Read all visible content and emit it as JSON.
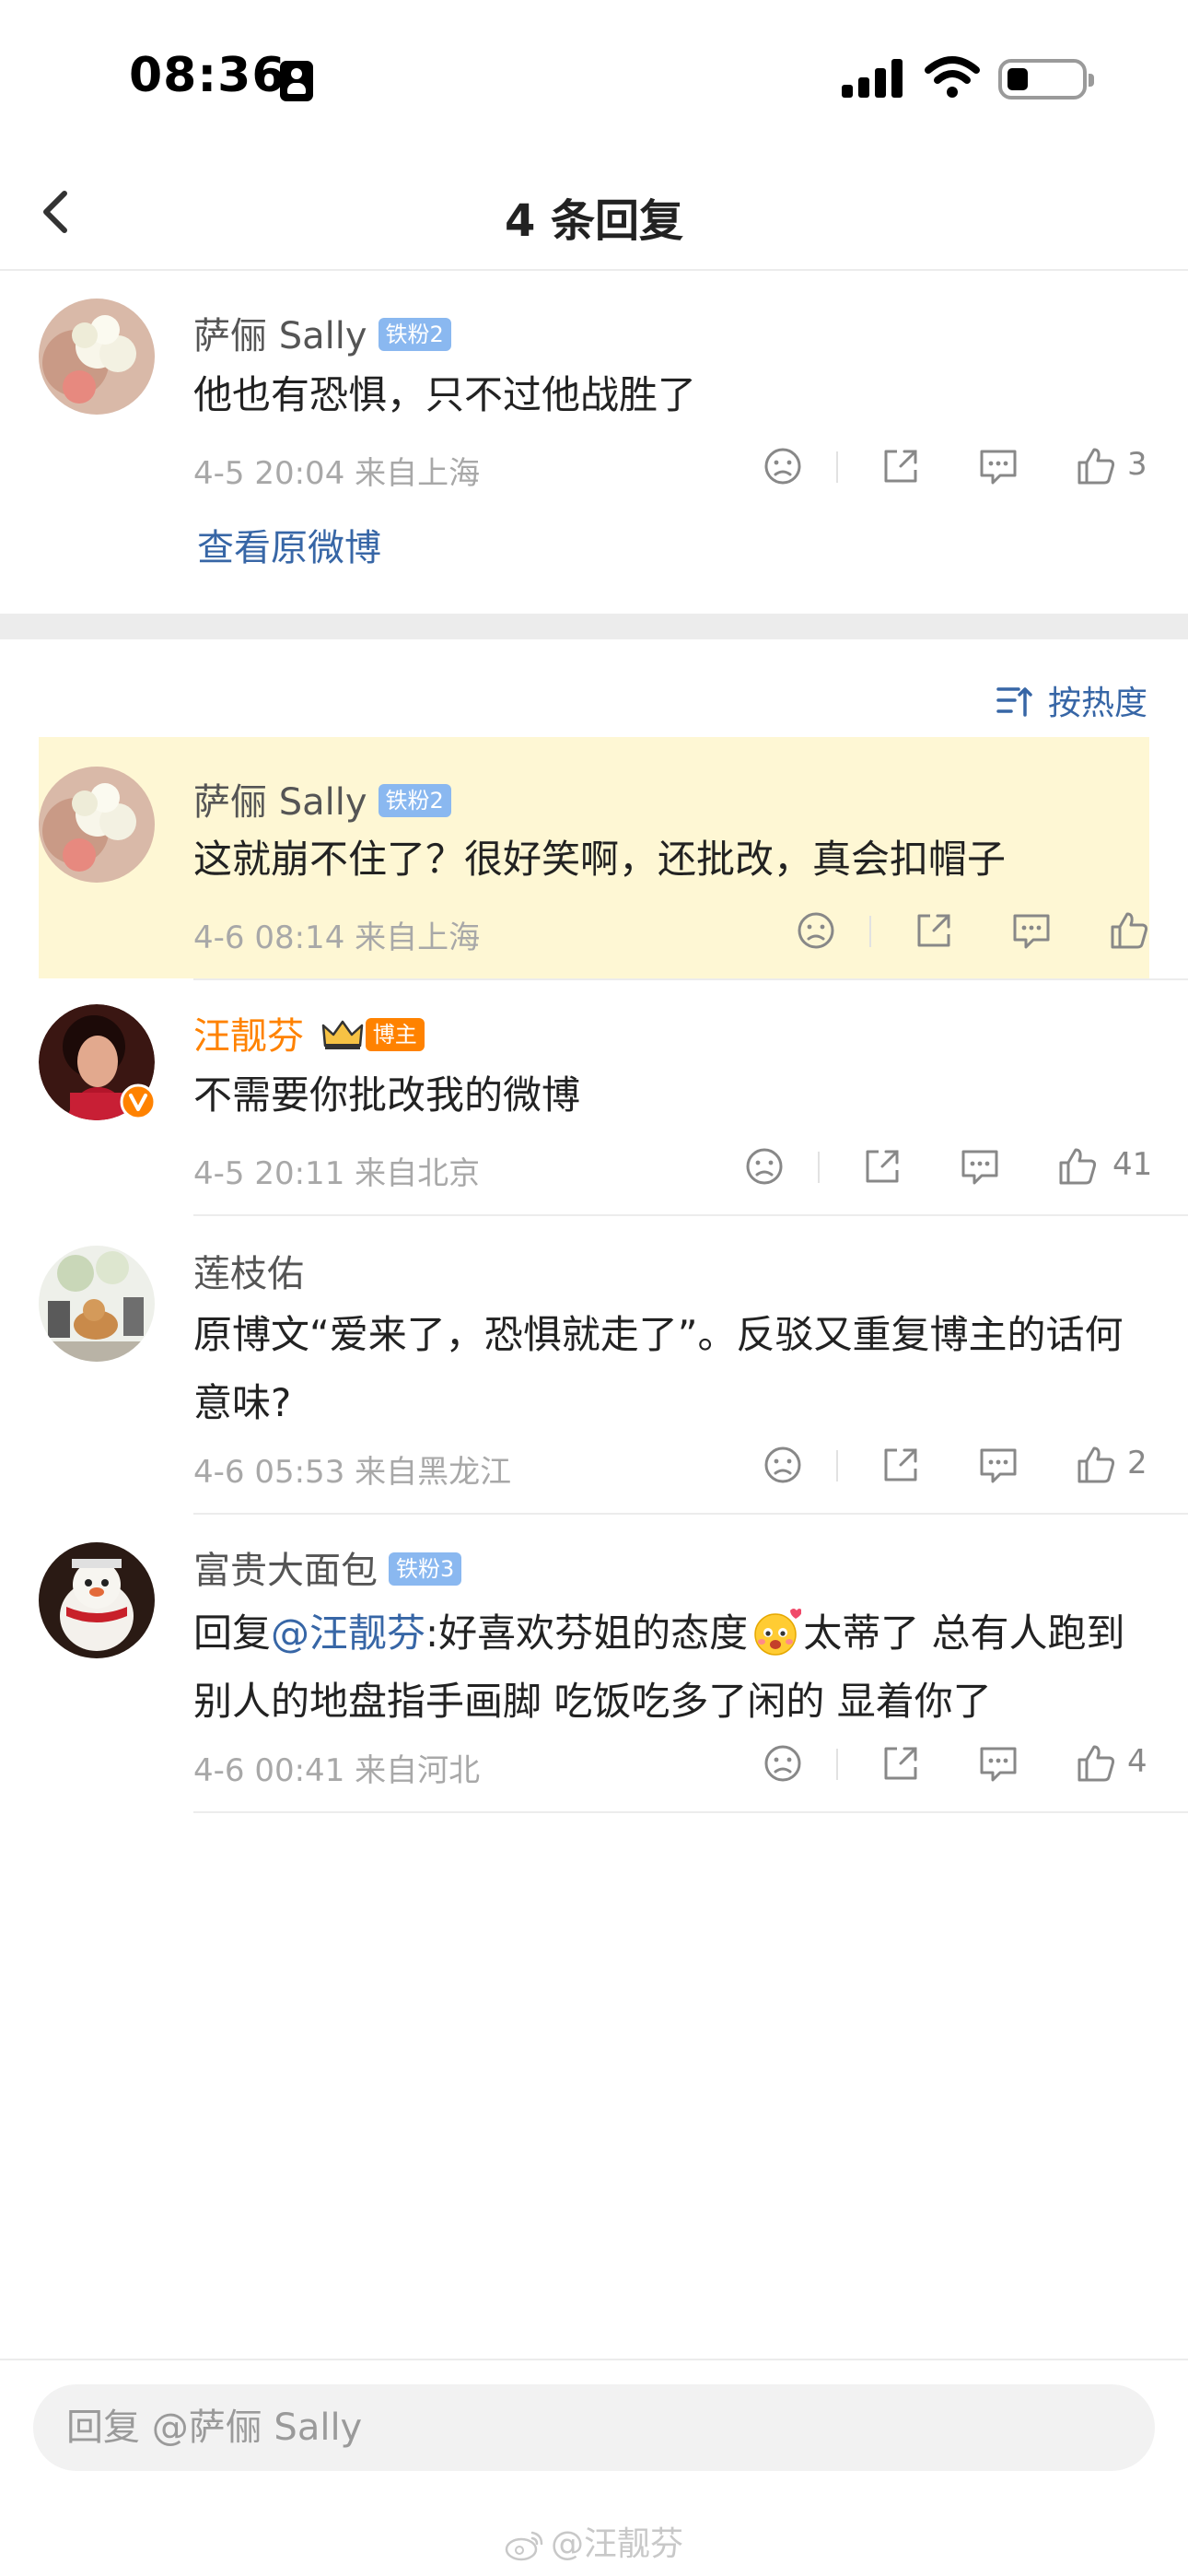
{
  "status_bar": {
    "time": "08:36"
  },
  "header": {
    "title": "4 条回复"
  },
  "original_comment": {
    "name": "萨俪 Sally",
    "badge": "铁粉2",
    "text": "他也有恐惧，只不过他战胜了",
    "meta": "4-5 20:04  来自上海",
    "likes": "3",
    "view_original": "查看原微博"
  },
  "sort": {
    "label": "按热度"
  },
  "replies": [
    {
      "name": "萨俪 Sally",
      "badge": "铁粉2",
      "text": "这就崩不住了？很好笑啊，还批改，真会扣帽子",
      "meta": "4-6 08:14  来自上海",
      "likes": ""
    },
    {
      "name": "汪靓芬",
      "badge": "博主",
      "text": "不需要你批改我的微博",
      "meta": "4-5 20:11  来自北京",
      "likes": "41"
    },
    {
      "name": "莲枝佑",
      "badge": "",
      "text": "原博文“爱来了，恐惧就走了”。反驳又重复博主的话何意味?",
      "meta": "4-6 05:53  来自黑龙江",
      "likes": "2"
    },
    {
      "name": "富贵大面包",
      "badge": "铁粉3",
      "text_prefix": "回复",
      "mention": "@汪靓芬",
      "text_mid": ":好喜欢芬姐的态度",
      "text_suffix": "太蒂了 总有人跑到别人的地盘指手画脚  吃饭吃多了闲的 显着你了",
      "meta": "4-6 00:41  来自河北",
      "likes": "4"
    }
  ],
  "reply_input": {
    "placeholder": "回复 @萨俪 Sally"
  },
  "watermark": "@汪靓芬",
  "colors": {
    "link": "#3766a6",
    "vip_name": "#ff8200",
    "highlight": "#fef7d4",
    "badge": "#8ab8f0"
  }
}
